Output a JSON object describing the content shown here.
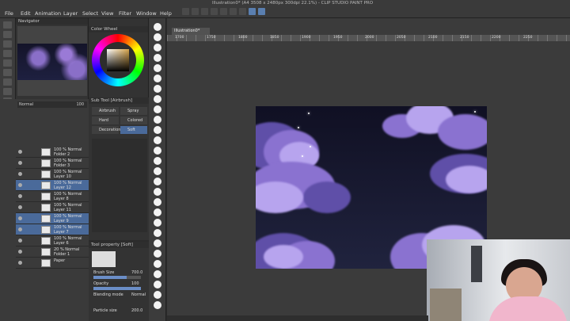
{
  "window": {
    "title": "Illustration0* (A4 3508 x 2480px 300dpi 22.1%) - CLIP STUDIO PAINT PRO"
  },
  "menu": [
    "File",
    "Edit",
    "Animation",
    "Layer",
    "Select",
    "View",
    "Filter",
    "Window",
    "Help"
  ],
  "panels": {
    "navigator": "Navigator",
    "color_wheel": "Color Wheel",
    "sub_tool": "Sub Tool [Airbrush]",
    "tool_property": "Tool property [Soft]",
    "layer_blend": "Normal",
    "layer_opacity": "100"
  },
  "subtools": [
    "Airbrush",
    "Spray",
    "Hard",
    "Colored",
    "Decoration",
    "Soft"
  ],
  "layers": [
    {
      "name": "100 % Normal\nFolder 2"
    },
    {
      "name": "100 % Normal\nFolder 3"
    },
    {
      "name": "100 % Normal\nLayer 10"
    },
    {
      "name": "100 % Normal\nLayer 12"
    },
    {
      "name": "100 % Normal\nLayer 8"
    },
    {
      "name": "100 % Normal\nLayer 11"
    },
    {
      "name": "100 % Normal\nLayer 9"
    },
    {
      "name": "100 % Normal\nLayer 7"
    },
    {
      "name": "100 % Normal\nLayer 6"
    },
    {
      "name": "20 % Normal\nFolder 1"
    },
    {
      "name": "Paper"
    }
  ],
  "tool_property": {
    "brush_size_label": "Brush Size",
    "brush_size": "700.0",
    "opacity_label": "Opacity",
    "opacity": "100",
    "blending_label": "Blending mode",
    "blending": "Normal",
    "particle_label": "Particle size",
    "particle_size": "200.0"
  },
  "canvas_tab": "Illustration0*",
  "ruler": [
    "1700",
    "1750",
    "1800",
    "1850",
    "1900",
    "1950",
    "2000",
    "2050",
    "2100",
    "2150",
    "2200",
    "2250"
  ],
  "colors": {
    "accent": "#4a6a9a",
    "cloud": "#8a72d0",
    "sky": "#15152b"
  }
}
